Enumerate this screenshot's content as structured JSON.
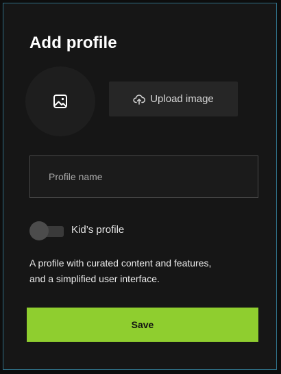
{
  "dialog": {
    "title": "Add profile"
  },
  "avatar": {
    "icon": "image-icon"
  },
  "upload": {
    "label": "Upload image",
    "icon": "cloud-upload-icon"
  },
  "profile_name": {
    "placeholder": "Profile name",
    "value": ""
  },
  "kids_toggle": {
    "label": "Kid’s profile",
    "enabled": false
  },
  "description": {
    "line1": "A profile with curated content and features,",
    "line2": "and a simplified user interface."
  },
  "save": {
    "label": "Save"
  },
  "colors": {
    "background": "#161616",
    "accent": "#8fce2f",
    "border": "#2f6f86"
  }
}
